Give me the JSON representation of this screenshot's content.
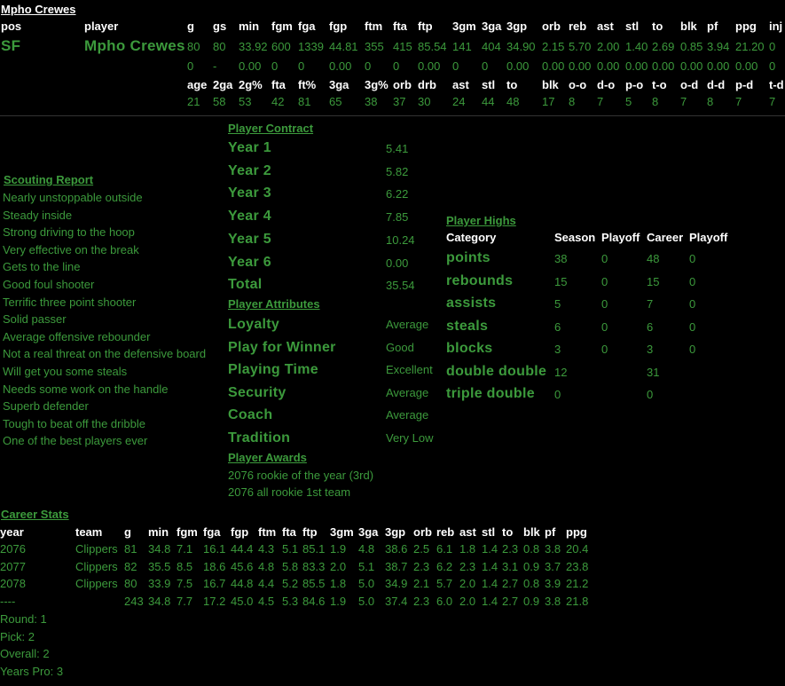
{
  "header": {
    "name": "Mpho Crewes",
    "stat_cols": [
      "pos",
      "player",
      "g",
      "gs",
      "min",
      "fgm",
      "fga",
      "fgp",
      "ftm",
      "fta",
      "ftp",
      "3gm",
      "3ga",
      "3gp",
      "orb",
      "reb",
      "ast",
      "stl",
      "to",
      "blk",
      "pf",
      "ppg",
      "inj"
    ],
    "row1": [
      "SF",
      "Mpho Crewes",
      "80",
      "80",
      "33.92",
      "600",
      "1339",
      "44.81",
      "355",
      "415",
      "85.54",
      "141",
      "404",
      "34.90",
      "2.15",
      "5.70",
      "2.00",
      "1.40",
      "2.69",
      "0.85",
      "3.94",
      "21.20",
      "0"
    ],
    "row2": [
      "0",
      "-",
      "0.00",
      "0",
      "0",
      "0.00",
      "0",
      "0",
      "0.00",
      "0",
      "0",
      "0.00",
      "0.00",
      "0.00",
      "0.00",
      "0.00",
      "0.00",
      "0.00",
      "0.00",
      "0.00",
      "0"
    ],
    "rating_cols": [
      "age",
      "2ga",
      "2g%",
      "fta",
      "ft%",
      "3ga",
      "3g%",
      "orb",
      "drb",
      "ast",
      "stl",
      "to",
      "blk",
      "o-o",
      "d-o",
      "p-o",
      "t-o",
      "o-d",
      "d-d",
      "p-d",
      "t-d"
    ],
    "ratings": [
      "21",
      "58",
      "53",
      "42",
      "81",
      "65",
      "38",
      "37",
      "30",
      "24",
      "44",
      "48",
      "17",
      "8",
      "7",
      "5",
      "8",
      "7",
      "8",
      "7",
      "7"
    ]
  },
  "scouting": {
    "title": "Scouting Report",
    "lines": [
      "Nearly unstoppable outside",
      "Steady inside",
      "Strong driving to the hoop",
      "Very effective on the break",
      "Gets to the line",
      "Good foul shooter",
      "Terrific three point shooter",
      "Solid passer",
      "Average offensive rebounder",
      "Not a real threat on the defensive board",
      "Will get you some steals",
      "Needs some work on the handle",
      "Superb defender",
      "Tough to beat off the dribble",
      "One of the best players ever"
    ]
  },
  "contract": {
    "title": "Player Contract",
    "rows": [
      {
        "label": "Year 1",
        "value": "5.41"
      },
      {
        "label": "Year 2",
        "value": "5.82"
      },
      {
        "label": "Year 3",
        "value": "6.22"
      },
      {
        "label": "Year 4",
        "value": "7.85"
      },
      {
        "label": "Year 5",
        "value": "10.24"
      },
      {
        "label": "Year 6",
        "value": "0.00"
      },
      {
        "label": "Total",
        "value": "35.54"
      }
    ]
  },
  "attributes": {
    "title": "Player Attributes",
    "rows": [
      {
        "label": "Loyalty",
        "value": "Average"
      },
      {
        "label": "Play for Winner",
        "value": "Good"
      },
      {
        "label": "Playing Time",
        "value": "Excellent"
      },
      {
        "label": "Security",
        "value": "Average"
      },
      {
        "label": "Coach",
        "value": "Average"
      },
      {
        "label": "Tradition",
        "value": "Very Low"
      }
    ]
  },
  "awards": {
    "title": "Player Awards",
    "lines": [
      "2076 rookie of the year (3rd)",
      "2076 all rookie 1st team"
    ]
  },
  "highs": {
    "title": "Player Highs",
    "headers": [
      "Category",
      "Season",
      "Playoff",
      "Career",
      "Playoff"
    ],
    "rows": [
      {
        "cat": "points",
        "s": "38",
        "sp": "0",
        "c": "48",
        "cp": "0"
      },
      {
        "cat": "rebounds",
        "s": "15",
        "sp": "0",
        "c": "15",
        "cp": "0"
      },
      {
        "cat": "assists",
        "s": "5",
        "sp": "0",
        "c": "7",
        "cp": "0"
      },
      {
        "cat": "steals",
        "s": "6",
        "sp": "0",
        "c": "6",
        "cp": "0"
      },
      {
        "cat": "blocks",
        "s": "3",
        "sp": "0",
        "c": "3",
        "cp": "0"
      },
      {
        "cat": "double double",
        "s": "12",
        "sp": "",
        "c": "31",
        "cp": ""
      },
      {
        "cat": "triple double",
        "s": "0",
        "sp": "",
        "c": "0",
        "cp": ""
      }
    ]
  },
  "career": {
    "title": "Career Stats",
    "cols": [
      "year",
      "team",
      "g",
      "min",
      "fgm",
      "fga",
      "fgp",
      "ftm",
      "fta",
      "ftp",
      "3gm",
      "3ga",
      "3gp",
      "orb",
      "reb",
      "ast",
      "stl",
      "to",
      "blk",
      "pf",
      "ppg"
    ],
    "rows": [
      [
        "2076",
        "Clippers",
        "81",
        "34.8",
        "7.1",
        "16.1",
        "44.4",
        "4.3",
        "5.1",
        "85.1",
        "1.9",
        "4.8",
        "38.6",
        "2.5",
        "6.1",
        "1.8",
        "1.4",
        "2.3",
        "0.8",
        "3.8",
        "20.4"
      ],
      [
        "2077",
        "Clippers",
        "82",
        "35.5",
        "8.5",
        "18.6",
        "45.6",
        "4.8",
        "5.8",
        "83.3",
        "2.0",
        "5.1",
        "38.7",
        "2.3",
        "6.2",
        "2.3",
        "1.4",
        "3.1",
        "0.9",
        "3.7",
        "23.8"
      ],
      [
        "2078",
        "Clippers",
        "80",
        "33.9",
        "7.5",
        "16.7",
        "44.8",
        "4.4",
        "5.2",
        "85.5",
        "1.8",
        "5.0",
        "34.9",
        "2.1",
        "5.7",
        "2.0",
        "1.4",
        "2.7",
        "0.8",
        "3.9",
        "21.2"
      ],
      [
        "----",
        "",
        "243",
        "34.8",
        "7.7",
        "17.2",
        "45.0",
        "4.5",
        "5.3",
        "84.6",
        "1.9",
        "5.0",
        "37.4",
        "2.3",
        "6.0",
        "2.0",
        "1.4",
        "2.7",
        "0.9",
        "3.8",
        "21.8"
      ]
    ]
  },
  "draft": {
    "lines": [
      "Round: 1",
      "Pick: 2",
      "Overall: 2",
      "Years Pro: 3"
    ]
  }
}
